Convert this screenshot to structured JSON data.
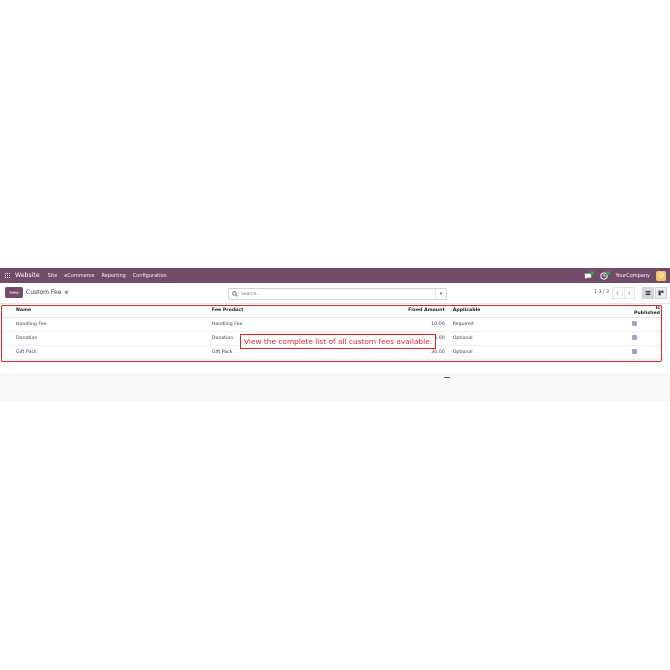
{
  "topbar": {
    "app_name": "Website",
    "menu": [
      "Site",
      "eCommerce",
      "Reporting",
      "Configuration"
    ],
    "company": "YourCompany"
  },
  "control": {
    "new_label": "New",
    "breadcrumb": "Custom Fee",
    "search_placeholder": "Search...",
    "pager": "1-3 / 3"
  },
  "table": {
    "headers": {
      "name": "Name",
      "fee_product": "Fee Product",
      "fixed_amount": "Fixed Amount",
      "applicable": "Applicable",
      "is_published": "Is Published"
    },
    "rows": [
      {
        "name": "Handling Fee",
        "fee_product": "Handling Fee",
        "fixed_amount": "10.00",
        "applicable": "Required",
        "is_published": true
      },
      {
        "name": "Donation",
        "fee_product": "Donation",
        "fixed_amount": "5.00",
        "applicable": "Optional",
        "is_published": true
      },
      {
        "name": "Gift Pack",
        "fee_product": "Gift Pack",
        "fixed_amount": "30.00",
        "applicable": "Optional",
        "is_published": true
      }
    ]
  },
  "callout": {
    "text": "View the complete list of all custom fees available."
  },
  "colors": {
    "brand": "#714b67",
    "annotation": "#e02424",
    "checkbox": "#9ca3c9"
  }
}
